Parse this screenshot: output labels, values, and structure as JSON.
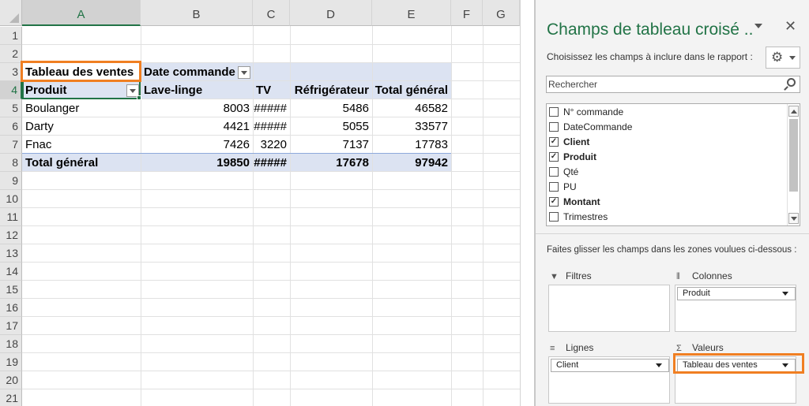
{
  "sheet": {
    "columns": [
      "A",
      "B",
      "C",
      "D",
      "E",
      "F",
      "G"
    ],
    "rows": [
      "1",
      "2",
      "3",
      "4",
      "5",
      "6",
      "7",
      "8",
      "9",
      "10",
      "11",
      "12",
      "13",
      "14",
      "15",
      "16",
      "17",
      "18",
      "19",
      "20",
      "21"
    ],
    "pivot": {
      "values_label": "Tableau des ventes",
      "col_field_label": "Date commande",
      "row_field_label": "Produit",
      "headers": [
        "Lave-linge",
        "TV",
        "Réfrigérateur",
        "Total général"
      ],
      "rows": [
        {
          "label": "Boulanger",
          "cells": [
            "8003",
            "#####",
            "5486",
            "46582"
          ]
        },
        {
          "label": "Darty",
          "cells": [
            "4421",
            "#####",
            "5055",
            "33577"
          ]
        },
        {
          "label": "Fnac",
          "cells": [
            "7426",
            "3220",
            "7137",
            "17783"
          ]
        }
      ],
      "total": {
        "label": "Total général",
        "cells": [
          "19850",
          "#####",
          "17678",
          "97942"
        ]
      }
    }
  },
  "pane": {
    "title": "Champs de tableau croisé ..",
    "close_glyph": "✕",
    "subtitle": "Choisissez les champs à inclure dans le rapport :",
    "gear_glyph": "⚙",
    "search_placeholder": "Rechercher",
    "fields": [
      {
        "label": "N° commande",
        "checked": false
      },
      {
        "label": "DateCommande",
        "checked": false
      },
      {
        "label": "Client",
        "checked": true
      },
      {
        "label": "Produit",
        "checked": true
      },
      {
        "label": "Qté",
        "checked": false
      },
      {
        "label": "PU",
        "checked": false
      },
      {
        "label": "Montant",
        "checked": true
      },
      {
        "label": "Trimestres",
        "checked": false
      }
    ],
    "hint": "Faites glisser les champs dans les zones voulues ci-dessous :",
    "zones": {
      "filters": {
        "label": "Filtres",
        "icon_glyph": "▼",
        "items": []
      },
      "columns": {
        "label": "Colonnes",
        "icon_glyph": "⦀",
        "items": [
          "Produit"
        ]
      },
      "rows": {
        "label": "Lignes",
        "icon_glyph": "≡",
        "items": [
          "Client"
        ]
      },
      "values": {
        "label": "Valeurs",
        "icon_glyph": "Σ",
        "items": [
          "Tableau des ventes"
        ]
      }
    }
  },
  "colors": {
    "accent": "#217346",
    "highlight": "#f07f22",
    "pivot_band": "#dce3f2"
  }
}
